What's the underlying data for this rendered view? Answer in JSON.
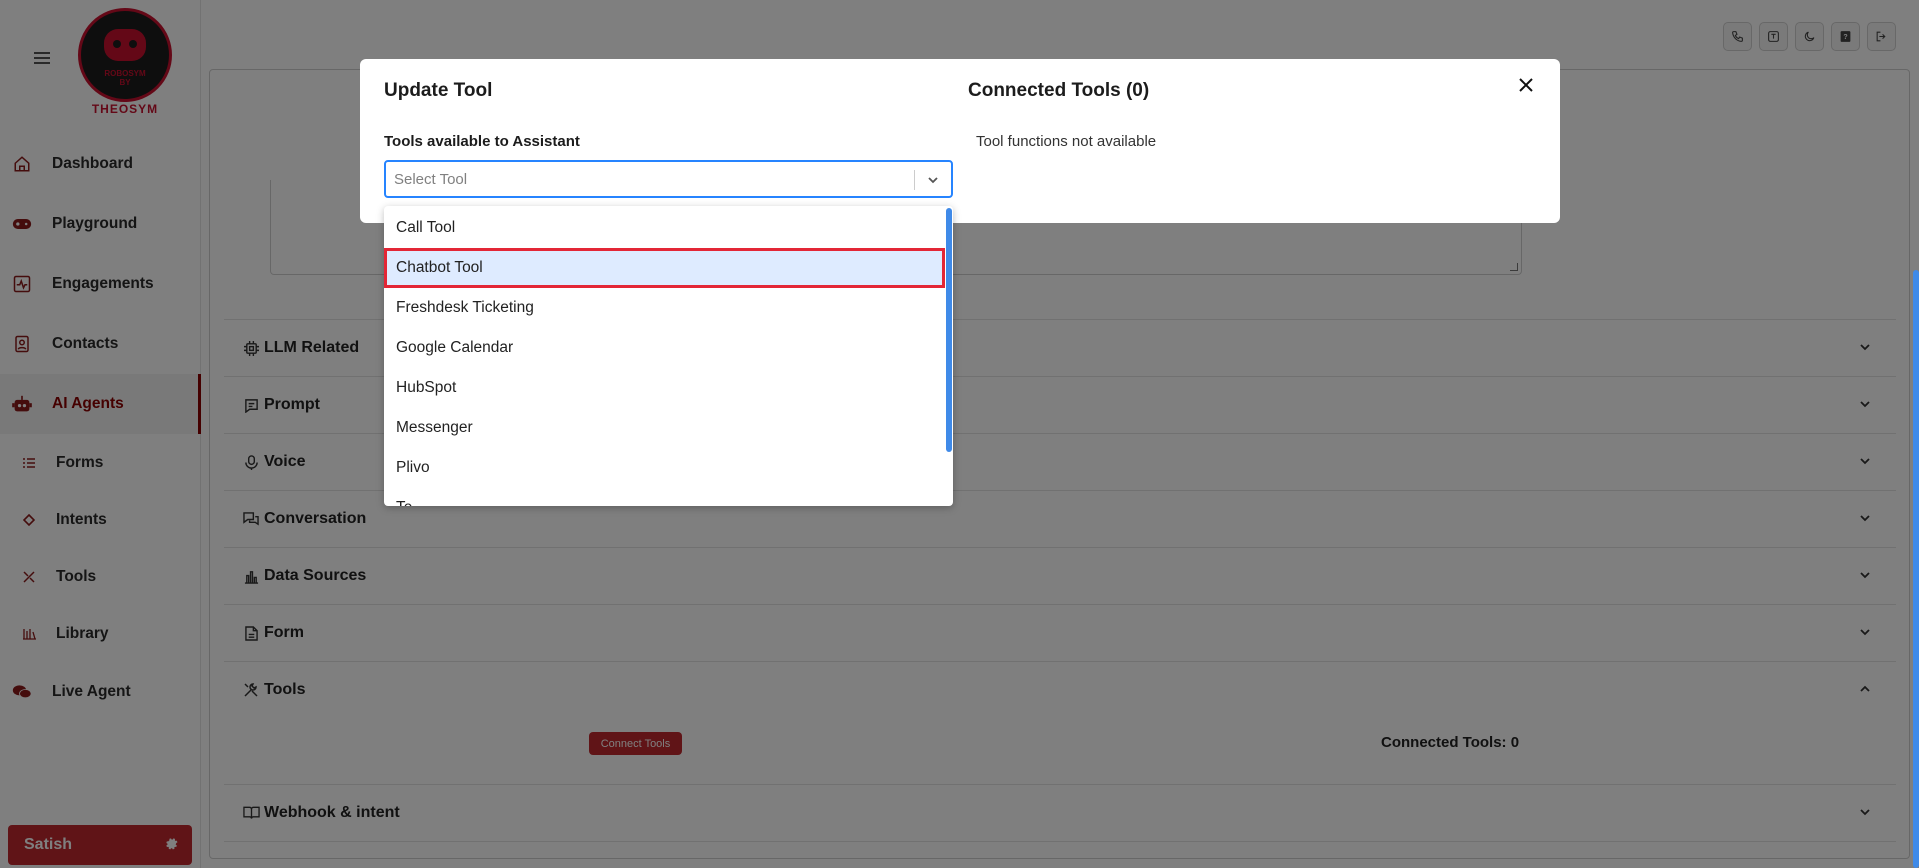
{
  "logo": {
    "brand": "THEOSYM",
    "sub_line1": "ROBOSYM",
    "sub_line2": "BY"
  },
  "sidebar": {
    "items": [
      {
        "label": "Dashboard",
        "icon": "home-icon"
      },
      {
        "label": "Playground",
        "icon": "gamepad-icon"
      },
      {
        "label": "Engagements",
        "icon": "activity-icon"
      },
      {
        "label": "Contacts",
        "icon": "contact-icon"
      },
      {
        "label": "AI Agents",
        "icon": "robot-icon",
        "active": true
      }
    ],
    "subitems": [
      {
        "label": "Forms",
        "icon": "list-icon"
      },
      {
        "label": "Intents",
        "icon": "diamond-icon"
      },
      {
        "label": "Tools",
        "icon": "tools-icon"
      },
      {
        "label": "Library",
        "icon": "library-icon"
      }
    ],
    "live_agent": {
      "label": "Live Agent",
      "icon": "chat-icon"
    },
    "user": {
      "name": "Satish",
      "icon": "gear-icon"
    }
  },
  "topbar": {
    "icons": [
      "phone-icon",
      "translate-icon",
      "moon-icon",
      "help-icon",
      "logout-icon"
    ]
  },
  "sections": [
    {
      "label": "LLM Related",
      "icon": "chip-icon",
      "expanded": false
    },
    {
      "label": "Prompt",
      "icon": "message-icon",
      "expanded": false
    },
    {
      "label": "Voice",
      "icon": "mic-icon",
      "expanded": false
    },
    {
      "label": "Conversation",
      "icon": "chat-bubbles-icon",
      "expanded": false
    },
    {
      "label": "Data Sources",
      "icon": "database-icon",
      "expanded": false
    },
    {
      "label": "Form",
      "icon": "document-icon",
      "expanded": false
    },
    {
      "label": "Tools",
      "icon": "tools-icon",
      "expanded": true
    },
    {
      "label": "Webhook & intent",
      "icon": "book-icon",
      "expanded": false
    }
  ],
  "tools_section": {
    "connect_button": "Connect Tools",
    "connected_label": "Connected Tools: 0"
  },
  "modal": {
    "title": "Update Tool",
    "right_title": "Connected Tools (0)",
    "field_label": "Tools available to Assistant",
    "placeholder": "Select Tool",
    "no_functions": "Tool functions not available",
    "options": [
      "Call Tool",
      "Chatbot Tool",
      "Freshdesk Ticketing",
      "Google Calendar",
      "HubSpot",
      "Messenger",
      "Plivo",
      "Te"
    ],
    "highlighted_option": "Chatbot Tool"
  },
  "colors": {
    "accent": "#c0282e",
    "focus": "#2684ff",
    "highlight": "#deebff",
    "highlight_border": "#e32636"
  }
}
